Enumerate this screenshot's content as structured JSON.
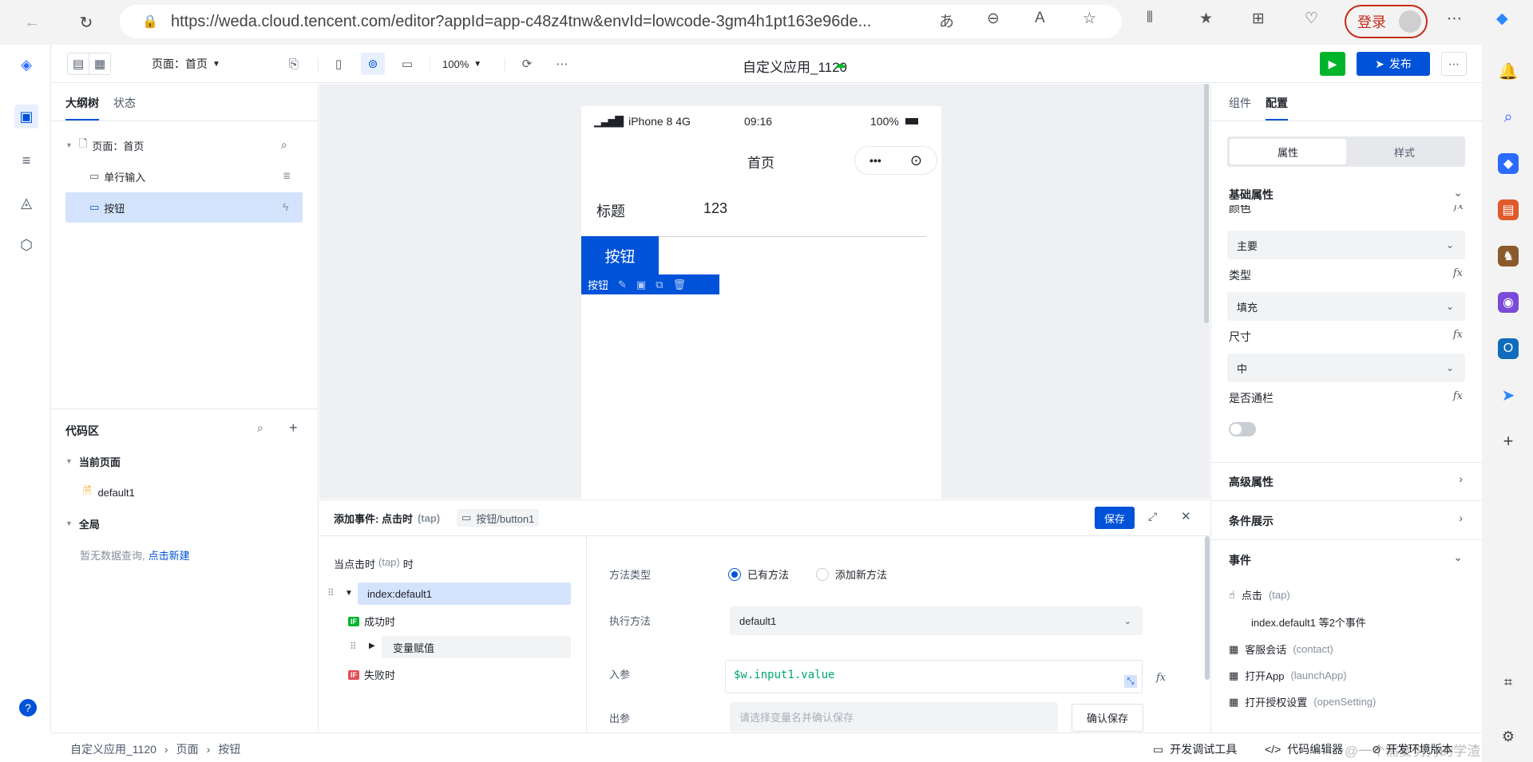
{
  "browser": {
    "url": "https://weda.cloud.tencent.com/editor?appId=app-c48z4tnw&envId=lowcode-3gm4h1pt163e96de...",
    "login_label": "登录"
  },
  "toolbar": {
    "page_selector": "页面：首页",
    "zoom": "100%",
    "app_title": "自定义应用_1120",
    "publish_label": "发布"
  },
  "outline": {
    "tabs": [
      "大纲树",
      "状态"
    ],
    "tree": {
      "page": "页面：首页",
      "input": "单行输入",
      "button": "按钮"
    }
  },
  "code": {
    "title": "代码区",
    "current_page": "当前页面",
    "default_file": "default1",
    "global": "全局",
    "empty_text": "暂无数据查询,",
    "create_link": "点击新建"
  },
  "phone": {
    "carrier": "iPhone 8  4G",
    "time": "09:16",
    "battery": "100%",
    "page_title": "首页",
    "label": "标题",
    "value": "123",
    "button_label": "按钮",
    "selection_tag": "按钮"
  },
  "event_panel": {
    "title": "添加事件: 点击时",
    "title_suffix": "(tap)",
    "component_chip": "按钮/button1",
    "save_label": "保存",
    "trigger_prefix": "当点击时",
    "trigger_tap": "(tap)",
    "trigger_suffix": "时",
    "action_selected": "index:default1",
    "success_label": "成功时",
    "assign_label": "变量赋值",
    "failure_label": "失败时",
    "if_badge": "IF",
    "method_type_label": "方法类型",
    "radio_existing": "已有方法",
    "radio_new": "添加新方法",
    "exec_method_label": "执行方法",
    "exec_method_value": "default1",
    "input_param_label": "入参",
    "input_param_value": "$w.input1.value",
    "output_param_label": "出参",
    "output_placeholder": "请选择变量名并确认保存",
    "confirm_save_label": "确认保存"
  },
  "right_panel": {
    "tabs": [
      "组件",
      "配置"
    ],
    "subtabs": [
      "属性",
      "样式"
    ],
    "basic_props": "基础属性",
    "color_label": "颜色",
    "color_value": "主要",
    "type_label": "类型",
    "type_value": "填充",
    "size_label": "尺寸",
    "size_value": "中",
    "block_label": "是否通栏",
    "block_on": false,
    "advanced_props": "高级属性",
    "conditional_display": "条件展示",
    "events": "事件",
    "event_items": [
      {
        "label": "点击",
        "code": "(tap)"
      },
      {
        "label": "客服会话",
        "code": "(contact)"
      },
      {
        "label": "打开App",
        "code": "(launchApp)"
      },
      {
        "label": "打开授权设置",
        "code": "(openSetting)"
      }
    ],
    "click_event_detail": "index.default1 等2个事件",
    "fx": "fx"
  },
  "statusbar": {
    "breadcrumb": [
      "自定义应用_1120",
      "页面",
      "按钮"
    ],
    "devtools": "开发调试工具",
    "code_editor": "代码编辑器",
    "dev_version": "开发环境版本",
    "watermark": "@一个需要努力的学渣"
  },
  "colors": {
    "primary": "#0052d9",
    "run": "#00b42a",
    "login": "#c42b1c"
  }
}
